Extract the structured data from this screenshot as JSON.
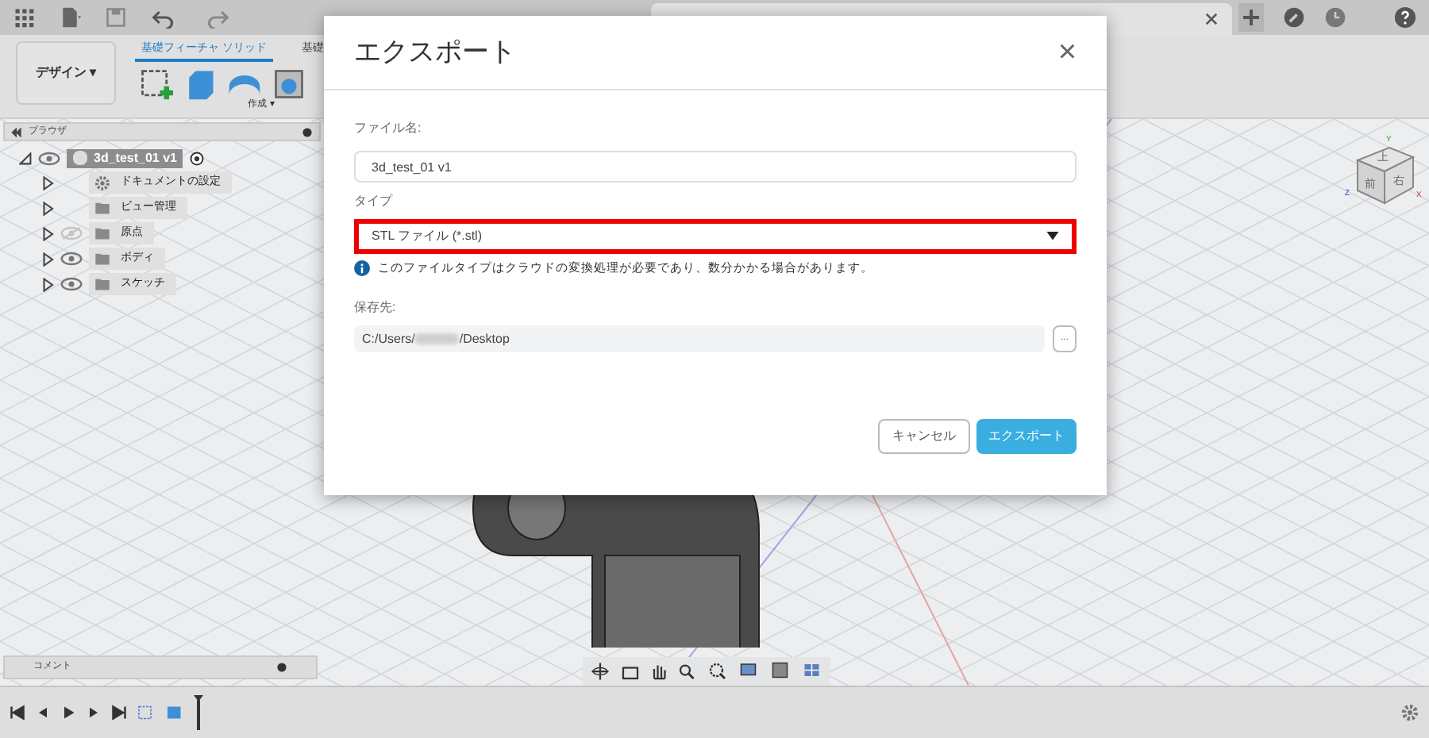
{
  "ribbon": {
    "workspace": "デザイン",
    "workspace_caret": "▾",
    "tabs": [
      {
        "label": "基礎フィーチャ ソリッド",
        "selected": true
      },
      {
        "label": "基礎",
        "selected": false
      }
    ],
    "group": "作成",
    "group_caret": "▾"
  },
  "browser": {
    "title": "ブラウザ",
    "root": {
      "label": "3d_test_01 v1",
      "visible": true,
      "expanded": true,
      "children": [
        {
          "label": "ドキュメントの設定",
          "kind": "settings"
        },
        {
          "label": "ビュー管理",
          "kind": "folder"
        },
        {
          "label": "原点",
          "kind": "folder",
          "visible": false
        },
        {
          "label": "ボディ",
          "kind": "folder",
          "visible": true
        },
        {
          "label": "スケッチ",
          "kind": "folder",
          "visible": true
        }
      ]
    }
  },
  "viewcube": {
    "top": "上",
    "front": "前",
    "right": "右",
    "axes": [
      "X",
      "Y",
      "Z"
    ]
  },
  "comments": {
    "title": "コメント"
  },
  "dialog": {
    "title": "エクスポート",
    "close": "×",
    "file_name": {
      "label": "ファイル名:",
      "value": "3d_test_01 v1"
    },
    "type": {
      "label": "タイプ",
      "value": "STL ファイル (*.stl)",
      "highlighted": true
    },
    "info": "このファイルタイプはクラウドの変換処理が必要であり、数分かかる場合があります。",
    "location": {
      "label": "保存先:",
      "value_start": "C:/Users/",
      "value_end": "/Desktop",
      "browse": "..."
    },
    "buttons": [
      {
        "label": "キャンセル",
        "kind": "secondary"
      },
      {
        "label": "エクスポート",
        "kind": "primary"
      }
    ]
  }
}
